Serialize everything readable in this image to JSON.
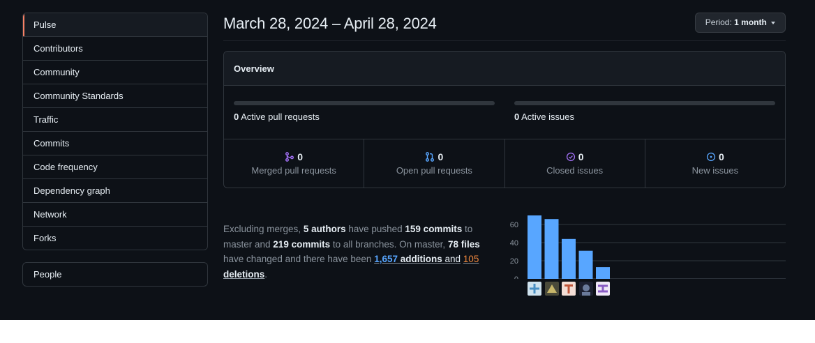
{
  "sidebar": {
    "items": [
      {
        "label": "Pulse",
        "selected": true
      },
      {
        "label": "Contributors"
      },
      {
        "label": "Community"
      },
      {
        "label": "Community Standards"
      },
      {
        "label": "Traffic"
      },
      {
        "label": "Commits"
      },
      {
        "label": "Code frequency"
      },
      {
        "label": "Dependency graph"
      },
      {
        "label": "Network"
      },
      {
        "label": "Forks"
      }
    ],
    "people": {
      "label": "People"
    }
  },
  "header": {
    "title": "March 28, 2024 – April 28, 2024",
    "period_label": "Period:",
    "period_value": "1 month"
  },
  "overview": {
    "title": "Overview",
    "active_pull_requests": {
      "count": "0",
      "label": "Active pull requests"
    },
    "active_issues": {
      "count": "0",
      "label": "Active issues"
    },
    "stats": [
      {
        "icon": "merged-pr-icon",
        "count": "0",
        "label": "Merged pull requests",
        "color": "#a371f7"
      },
      {
        "icon": "open-pr-icon",
        "count": "0",
        "label": "Open pull requests",
        "color": "#58a6ff"
      },
      {
        "icon": "closed-issue-icon",
        "count": "0",
        "label": "Closed issues",
        "color": "#a371f7"
      },
      {
        "icon": "new-issue-icon",
        "count": "0",
        "label": "New issues",
        "color": "#58a6ff"
      }
    ]
  },
  "summary": {
    "t1": "Excluding merges, ",
    "authors": "5 authors",
    "t2": " have pushed ",
    "commits_master": "159 commits",
    "t3": " to master and ",
    "commits_all": "219 commits",
    "t4": " to all branches. On master, ",
    "files": "78 files",
    "t5": " have changed and there have been ",
    "additions_num": "1,657",
    "additions_word": "additions",
    "t6": " and",
    "deletions_num": "105",
    "deletions_word": "deletions",
    "t7": "."
  },
  "chart_data": {
    "type": "bar",
    "categories": [
      "author-1",
      "author-2",
      "author-3",
      "author-4",
      "author-5"
    ],
    "values": [
      70,
      66,
      44,
      31,
      13
    ],
    "yticks": [
      "60",
      "40",
      "20",
      "0"
    ],
    "ylim": [
      0,
      60
    ],
    "grid": true,
    "bar_color": "#58a6ff"
  },
  "colors": {
    "accent": "#f78166",
    "link": "#58a6ff",
    "deletion": "#f0883e"
  }
}
